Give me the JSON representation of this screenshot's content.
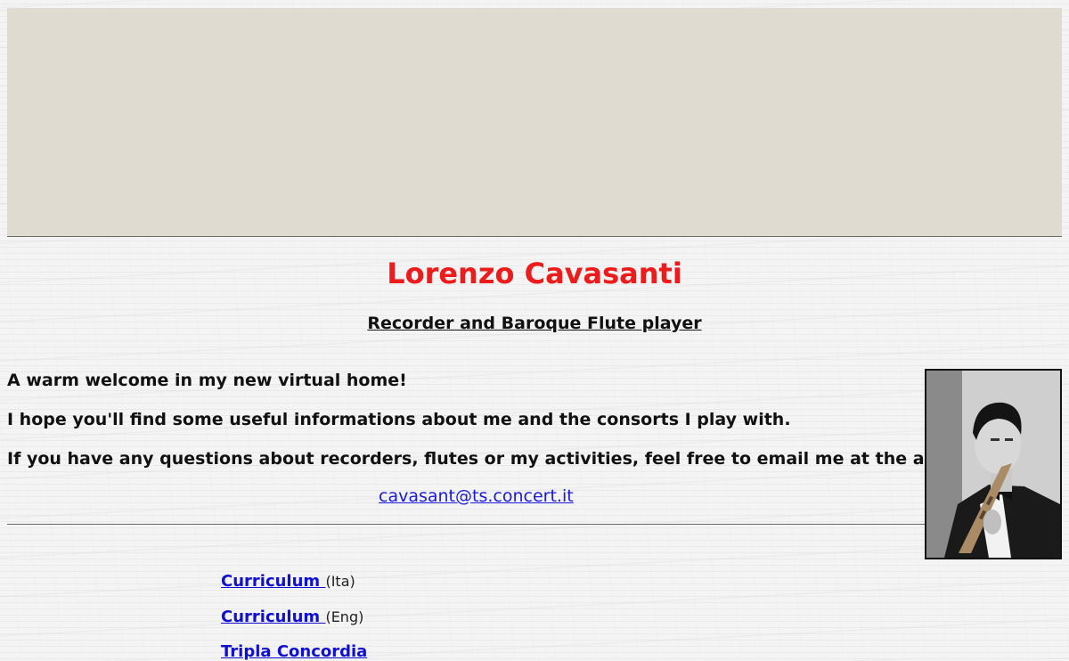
{
  "header": {
    "title": "Lorenzo Cavasanti",
    "subtitle": "Recorder and Baroque Flute player"
  },
  "intro": {
    "welcome": "A warm welcome in my new virtual home!",
    "hope": "I hope you'll find some useful informations about me and the consorts I play with.",
    "questions": "If you have any questions about recorders, flutes or my activities, feel free to email me at the address:",
    "email": "cavasant@ts.concert.it"
  },
  "nav": [
    {
      "label": "Curriculum ",
      "lang": "(Ita)"
    },
    {
      "label": "Curriculum ",
      "lang": "(Eng)"
    },
    {
      "label": "Tripla Concordia",
      "lang": ""
    }
  ],
  "colors": {
    "title": "#ec1c1c",
    "link": "#1010d0",
    "banner": "#dfdbd1"
  }
}
